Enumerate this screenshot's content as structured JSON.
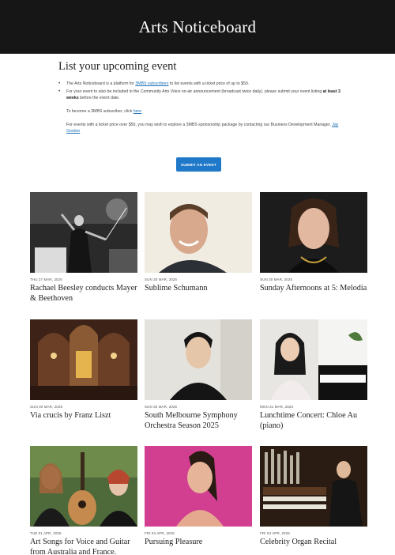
{
  "header": {
    "title": "Arts Noticeboard"
  },
  "intro": {
    "heading": "List your upcoming event",
    "bullet1_text": "The Arts Noticeboard is a platform for ",
    "bullet1_link": "3MBS subscribers",
    "bullet1_rest": " to list events with a ticket price of up to $50.",
    "bullet2_text": "For your event to also be included in the Community Arts Voice on-air announcement (broadcast twice daily), please submit your event listing ",
    "bullet2_bold": "at least 3 weeks",
    "bullet2_rest": " before the event date.",
    "subscriber_text": "To become a 3MBS subscriber, click ",
    "subscriber_link": "here",
    "sponsor_text": "For events with a ticket price over $50, you may wish to explore a 3MBS sponsorship package by contacting our Business Development Manager, ",
    "sponsor_link": "Jay Gordon"
  },
  "submit_label": "SUBMIT AN EVENT",
  "events": [
    {
      "date": "THU 27 MAR, 2025",
      "title": "Rachael Beesley conducts Mayer & Beethoven"
    },
    {
      "date": "SUN 30 MAR, 2025",
      "title": "Sublime Schumann"
    },
    {
      "date": "SUN 30 MAR, 2025",
      "title": "Sunday Afternoons at 5: Melodia"
    },
    {
      "date": "SUN 30 MAR, 2025",
      "title": "Via crucis by Franz Liszt"
    },
    {
      "date": "SUN 30 MAR, 2025",
      "title": "South Melbourne Symphony Orchestra Season 2025"
    },
    {
      "date": "MON 31 MAR, 2025",
      "title": "Lunchtime Concert: Chloe Au (piano)"
    },
    {
      "date": "TUE 01 APR, 2025",
      "title": "Art Songs for Voice and Guitar from Australia and France."
    },
    {
      "date": "FRI 04 APR, 2025",
      "title": "Pursuing Pleasure"
    },
    {
      "date": "FRI 04 APR, 2025",
      "title": "Celebrity Organ Recital"
    }
  ]
}
